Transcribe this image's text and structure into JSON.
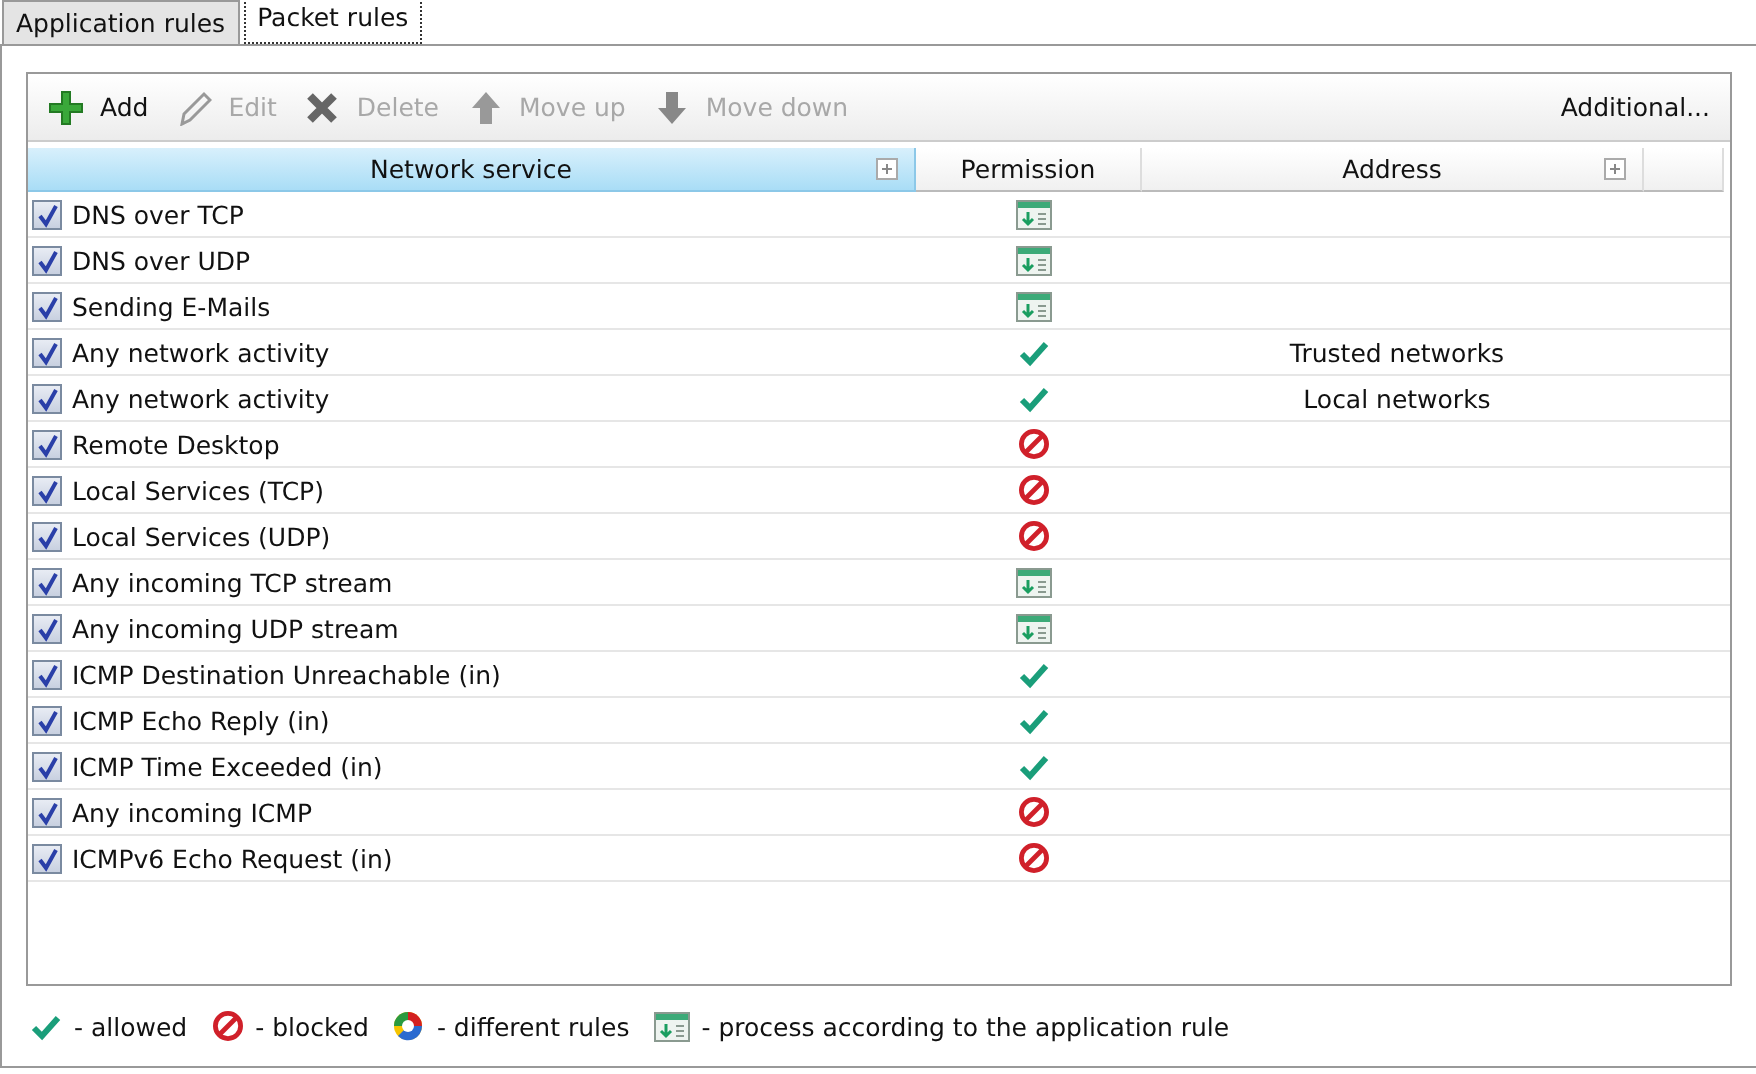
{
  "tabs": [
    {
      "label": "Application rules",
      "selected": false
    },
    {
      "label": "Packet rules",
      "selected": true
    }
  ],
  "toolbar": {
    "buttons": [
      {
        "label": "Add",
        "kind": "add",
        "disabled": false
      },
      {
        "label": "Edit",
        "kind": "edit",
        "disabled": true
      },
      {
        "label": "Delete",
        "kind": "delete",
        "disabled": true
      },
      {
        "label": "Move up",
        "kind": "up",
        "disabled": true
      },
      {
        "label": "Move down",
        "kind": "down",
        "disabled": true
      }
    ],
    "additional": "Additional..."
  },
  "table": {
    "columns": [
      {
        "label": "Network service",
        "selected": true,
        "expander": true
      },
      {
        "label": "Permission",
        "selected": false,
        "expander": false
      },
      {
        "label": "Address",
        "selected": false,
        "expander": true
      }
    ],
    "rows": [
      {
        "checked": true,
        "service": "DNS over TCP",
        "kind": "app"
      },
      {
        "checked": true,
        "service": "DNS over UDP",
        "kind": "app"
      },
      {
        "checked": true,
        "service": "Sending E-Mails",
        "kind": "app"
      },
      {
        "checked": true,
        "service": "Any network activity",
        "kind": "allow",
        "address": "Trusted networks"
      },
      {
        "checked": true,
        "service": "Any network activity",
        "kind": "allow",
        "address": "Local networks"
      },
      {
        "checked": true,
        "service": "Remote Desktop",
        "kind": "block"
      },
      {
        "checked": true,
        "service": "Local Services (TCP)",
        "kind": "block"
      },
      {
        "checked": true,
        "service": "Local Services (UDP)",
        "kind": "block"
      },
      {
        "checked": true,
        "service": "Any incoming TCP stream",
        "kind": "app"
      },
      {
        "checked": true,
        "service": "Any incoming UDP stream",
        "kind": "app"
      },
      {
        "checked": true,
        "service": "ICMP Destination Unreachable (in)",
        "kind": "allow"
      },
      {
        "checked": true,
        "service": "ICMP Echo Reply (in)",
        "kind": "allow"
      },
      {
        "checked": true,
        "service": "ICMP Time Exceeded (in)",
        "kind": "allow"
      },
      {
        "checked": true,
        "service": "Any incoming ICMP",
        "kind": "block"
      },
      {
        "checked": true,
        "service": "ICMPv6 Echo Request (in)",
        "kind": "block"
      }
    ]
  },
  "legend": [
    {
      "kind": "allow",
      "label": "- allowed"
    },
    {
      "kind": "block",
      "label": "- blocked"
    },
    {
      "kind": "mixed",
      "label": "- different rules"
    },
    {
      "kind": "app",
      "label": "- process according to the application rule"
    }
  ]
}
